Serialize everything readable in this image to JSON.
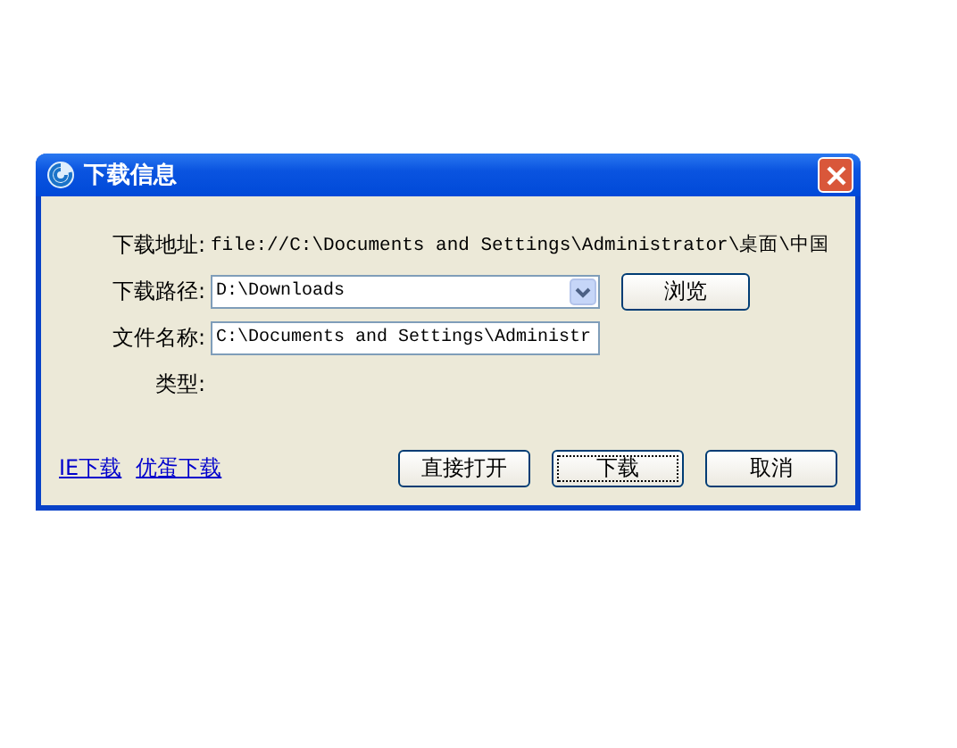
{
  "window": {
    "title": "下载信息"
  },
  "fields": [
    {
      "kind": "text",
      "label": "下载地址:",
      "value": "file://C:\\Documents and Settings\\Administrator\\桌面\\中国"
    },
    {
      "kind": "dropdown",
      "label": "下载路径:",
      "value": "D:\\Downloads",
      "button": "浏览"
    },
    {
      "kind": "input",
      "label": "文件名称:",
      "value": "C:\\Documents and Settings\\Administr"
    },
    {
      "kind": "text",
      "label": "类型:"
    }
  ],
  "links": [
    "IE下载",
    "优蛋下载"
  ],
  "buttons": [
    {
      "label": "直接打开",
      "focused": false
    },
    {
      "label": "下载",
      "focused": true
    },
    {
      "label": "取消",
      "focused": false
    }
  ]
}
